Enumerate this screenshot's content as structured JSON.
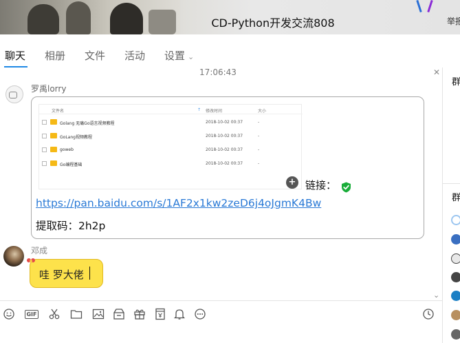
{
  "window": {
    "title": "CD-Python开发交流808",
    "report_label": "举报"
  },
  "tabs": [
    {
      "label": "聊天",
      "active": true
    },
    {
      "label": "相册",
      "active": false
    },
    {
      "label": "文件",
      "active": false
    },
    {
      "label": "活动",
      "active": false
    },
    {
      "label": "设置",
      "active": false
    }
  ],
  "chat": {
    "timestamp": "17:06:43",
    "messages": [
      {
        "sender": "罗禹lorry",
        "file_table": {
          "headers": {
            "name": "文件名",
            "modified": "修改时间",
            "size": "大小"
          },
          "rows": [
            {
              "name": "Golang 无痛Go语言视频教程",
              "modified": "2018-10-02 00:37",
              "size": "-"
            },
            {
              "name": "GoLang视频教程",
              "modified": "2018-10-02 00:37",
              "size": "-"
            },
            {
              "name": "goweb",
              "modified": "2018-10-02 00:37",
              "size": "-"
            },
            {
              "name": "Go编程基础",
              "modified": "2018-10-02 00:37",
              "size": "-"
            }
          ]
        },
        "link_label": "链接：",
        "url": "https://pan.baidu.com/s/1AF2x1kw2zeD6j4oJgmK4Bw",
        "extract_code": "提取码：2h2p"
      },
      {
        "sender": "邓成",
        "text": "哇 罗大佬"
      }
    ]
  },
  "toolbar": {
    "icons": [
      "emoji-icon",
      "gif-icon",
      "screenshot-icon",
      "folder-icon",
      "image-icon",
      "gift-box-icon",
      "present-icon",
      "red-packet-icon",
      "bell-icon",
      "more-icon",
      "history-clock-icon"
    ],
    "gif_label": "GIF"
  },
  "right_panel": {
    "section1_title": "群",
    "section2_title": "群"
  },
  "colors": {
    "accent": "#1e88e5",
    "link": "#2979d6",
    "bubble_yellow": "#fde24b",
    "shield_green": "#1aad3a",
    "folder": "#f5b916"
  }
}
